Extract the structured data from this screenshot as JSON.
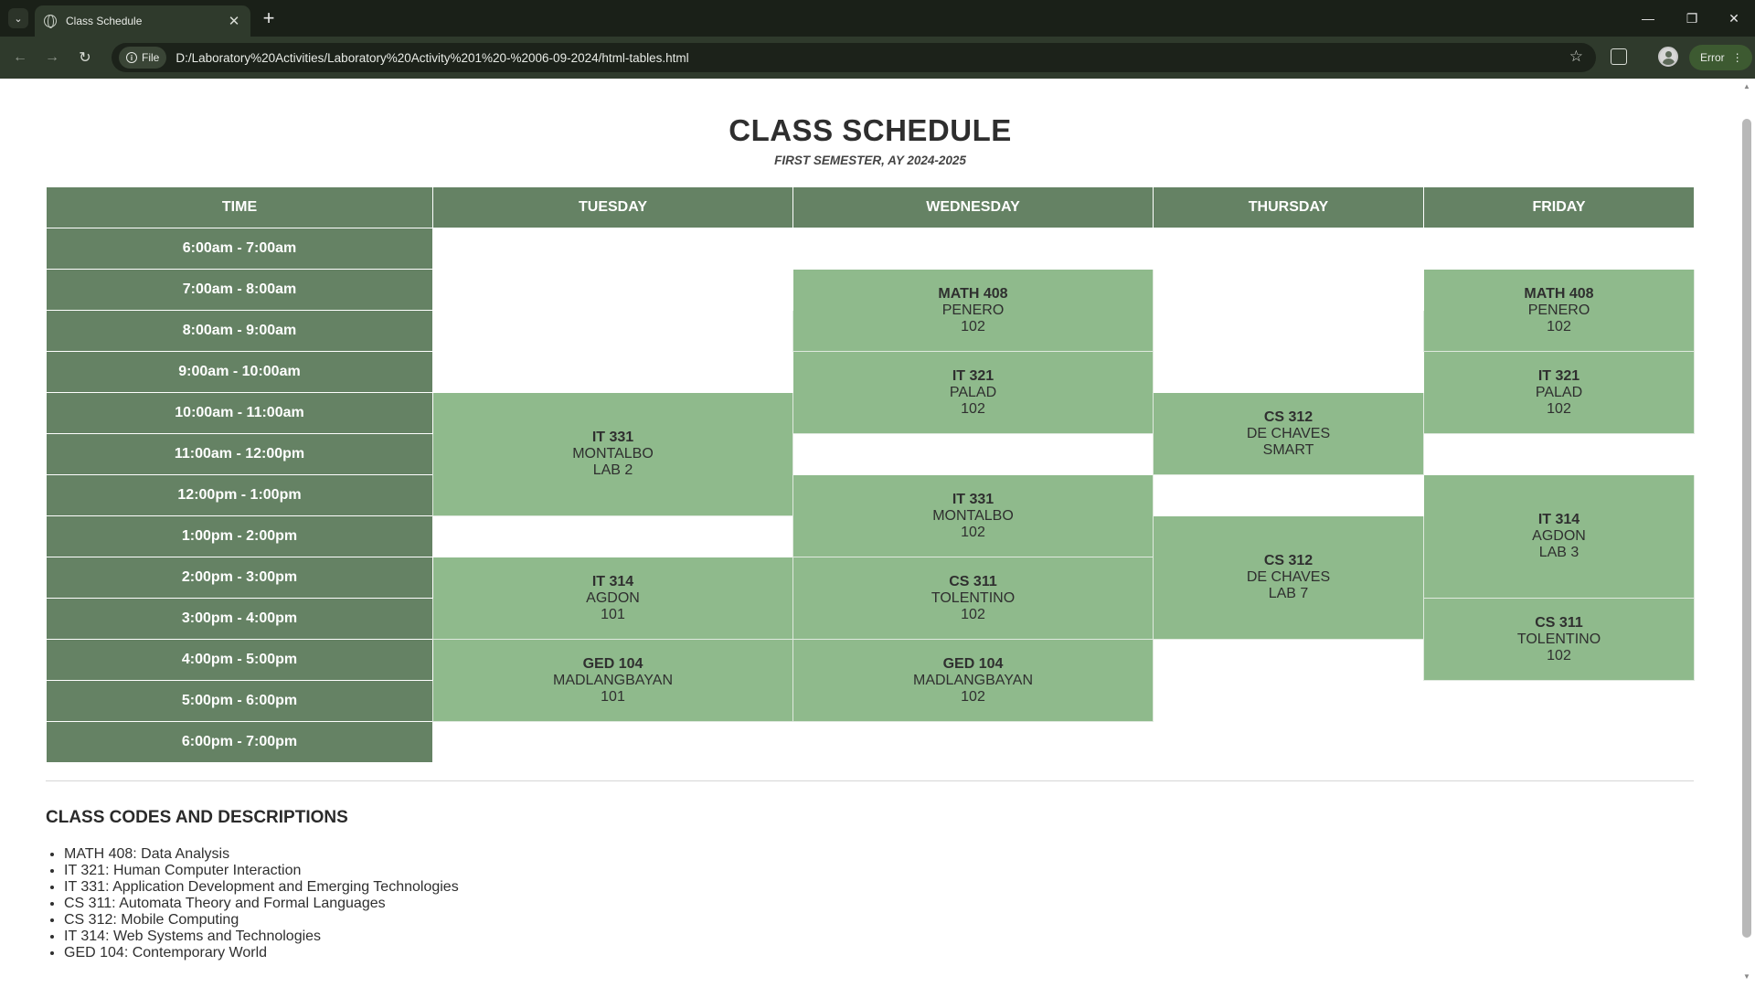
{
  "browser": {
    "tab_title": "Class Schedule",
    "tab_close": "✕",
    "new_tab": "+",
    "tab_search": "⌄",
    "minimize": "—",
    "restore": "❐",
    "close": "✕",
    "back": "←",
    "forward": "→",
    "reload": "↻",
    "site_chip": "File",
    "url": "D:/Laboratory%20Activities/Laboratory%20Activity%201%20-%2006-09-2024/html-tables.html",
    "bookmark": "☆",
    "error_label": "Error",
    "menu": "⋮"
  },
  "page": {
    "title": "CLASS SCHEDULE",
    "subtitle": "FIRST SEMESTER, AY 2024-2025",
    "headers": [
      "TIME",
      "TUESDAY",
      "WEDNESDAY",
      "THURSDAY",
      "FRIDAY"
    ],
    "times": [
      "6:00am - 7:00am",
      "7:00am - 8:00am",
      "8:00am - 9:00am",
      "9:00am - 10:00am",
      "10:00am - 11:00am",
      "11:00am - 12:00pm",
      "12:00pm - 1:00pm",
      "1:00pm - 2:00pm",
      "2:00pm - 3:00pm",
      "3:00pm - 4:00pm",
      "4:00pm - 5:00pm",
      "5:00pm - 6:00pm",
      "6:00pm - 7:00pm"
    ],
    "classes": {
      "tue_it331": {
        "code": "IT 331",
        "prof": "MONTALBO",
        "room": "LAB 2"
      },
      "tue_it314": {
        "code": "IT 314",
        "prof": "AGDON",
        "room": "101"
      },
      "tue_ged104": {
        "code": "GED 104",
        "prof": "MADLANGBAYAN",
        "room": "101"
      },
      "wed_math408": {
        "code": "MATH 408",
        "prof": "PENERO",
        "room": "102"
      },
      "wed_it321": {
        "code": "IT 321",
        "prof": "PALAD",
        "room": "102"
      },
      "wed_it331": {
        "code": "IT 331",
        "prof": "MONTALBO",
        "room": "102"
      },
      "wed_cs311": {
        "code": "CS 311",
        "prof": "TOLENTINO",
        "room": "102"
      },
      "wed_ged104": {
        "code": "GED 104",
        "prof": "MADLANGBAYAN",
        "room": "102"
      },
      "thu_cs312a": {
        "code": "CS 312",
        "prof": "DE CHAVES",
        "room": "SMART"
      },
      "thu_cs312b": {
        "code": "CS 312",
        "prof": "DE CHAVES",
        "room": "LAB 7"
      },
      "fri_math408": {
        "code": "MATH 408",
        "prof": "PENERO",
        "room": "102"
      },
      "fri_it321": {
        "code": "IT 321",
        "prof": "PALAD",
        "room": "102"
      },
      "fri_it314": {
        "code": "IT 314",
        "prof": "AGDON",
        "room": "LAB 3"
      },
      "fri_cs311": {
        "code": "CS 311",
        "prof": "TOLENTINO",
        "room": "102"
      }
    },
    "codes_title": "CLASS CODES AND DESCRIPTIONS",
    "codes": [
      "MATH 408: Data Analysis",
      "IT 321: Human Computer Interaction",
      "IT 331: Application Development and Emerging Technologies",
      "CS 311: Automata Theory and Formal Languages",
      "CS 312: Mobile Computing",
      "IT 314: Web Systems and Technologies",
      "GED 104: Contemporary World"
    ]
  },
  "colors": {
    "header_green": "#658264",
    "class_green": "#8fba8c",
    "chrome_dark": "#1a2018",
    "toolbar": "#2f3a2c"
  }
}
